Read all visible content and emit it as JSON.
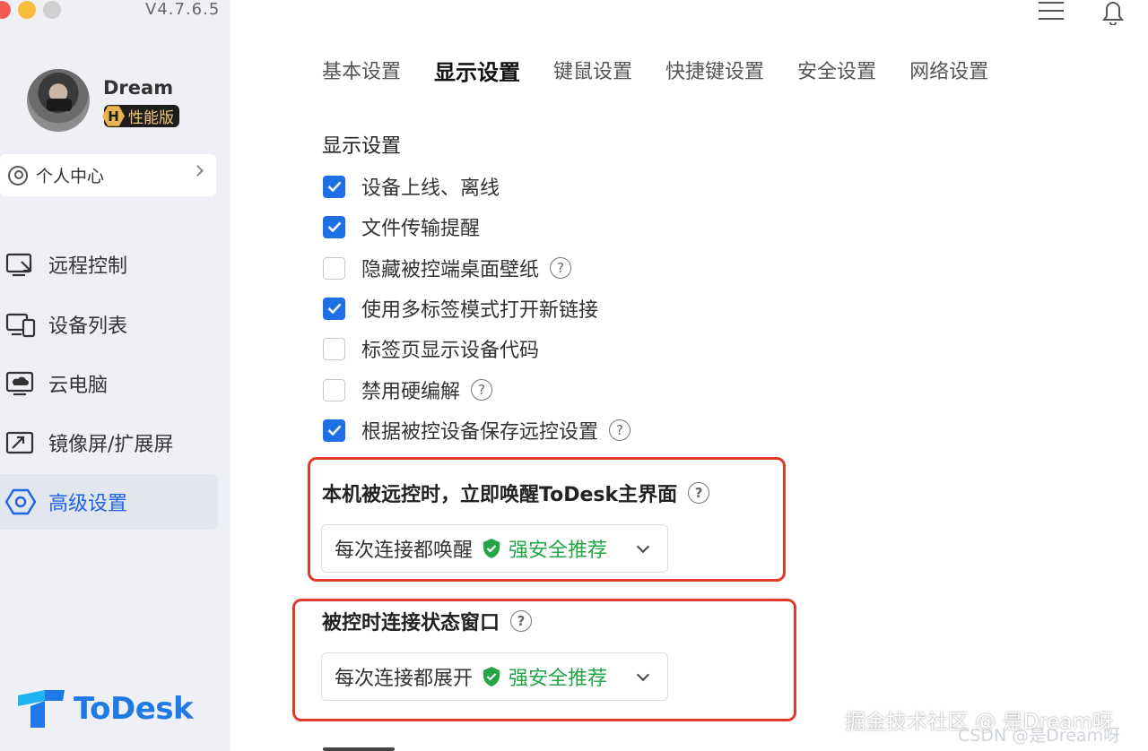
{
  "app": {
    "version": "V4.7.6.5",
    "brand": "ToDesk"
  },
  "user": {
    "name": "Dream",
    "badge_letter": "H",
    "badge_label": "性能版"
  },
  "sidebar": {
    "personal_center": "个人中心",
    "items": [
      {
        "label": "远程控制",
        "icon": "remote-control-icon",
        "active": false
      },
      {
        "label": "设备列表",
        "icon": "device-list-icon",
        "active": false
      },
      {
        "label": "云电脑",
        "icon": "cloud-pc-icon",
        "active": false
      },
      {
        "label": "镜像屏/扩展屏",
        "icon": "mirror-screen-icon",
        "active": false
      },
      {
        "label": "高级设置",
        "icon": "hex-settings-icon",
        "active": true
      }
    ]
  },
  "tabs": [
    {
      "label": "基本设置",
      "active": false
    },
    {
      "label": "显示设置",
      "active": true
    },
    {
      "label": "键鼠设置",
      "active": false
    },
    {
      "label": "快捷键设置",
      "active": false
    },
    {
      "label": "安全设置",
      "active": false
    },
    {
      "label": "网络设置",
      "active": false
    }
  ],
  "display": {
    "title": "显示设置",
    "options": [
      {
        "label": "设备上线、离线",
        "checked": true,
        "help": false
      },
      {
        "label": "文件传输提醒",
        "checked": true,
        "help": false
      },
      {
        "label": "隐藏被控端桌面壁纸",
        "checked": false,
        "help": true
      },
      {
        "label": "使用多标签模式打开新链接",
        "checked": true,
        "help": false
      },
      {
        "label": "标签页显示设备代码",
        "checked": false,
        "help": false
      },
      {
        "label": "禁用硬编解",
        "checked": false,
        "help": true
      },
      {
        "label": "根据被控设备保存远控设置",
        "checked": true,
        "help": true
      }
    ]
  },
  "wake": {
    "title": "本机被远控时，立即唤醒ToDesk主界面",
    "value": "每次连接都唤醒",
    "recommend": "强安全推荐"
  },
  "status_window": {
    "title": "被控时连接状态窗口",
    "value": "每次连接都展开",
    "recommend": "强安全推荐"
  },
  "watermark": {
    "primary": "掘金技术社区 @ 是Dream呀",
    "secondary": "CSDN @是Dream呀"
  },
  "colors": {
    "accent": "#1f6fe5",
    "sidebar_bg": "#eef0f5",
    "highlight": "#e03a2a",
    "recommend": "#22a447"
  }
}
